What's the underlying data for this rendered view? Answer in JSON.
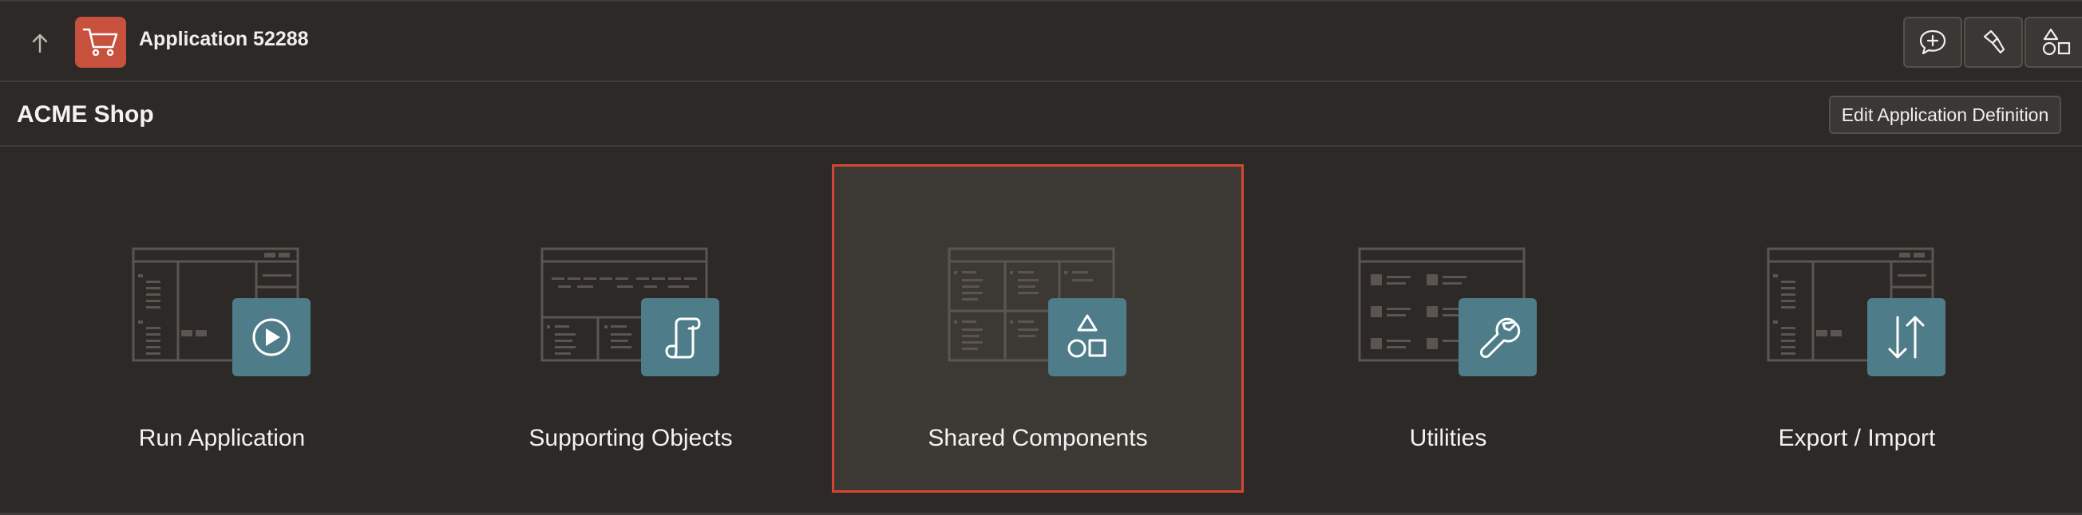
{
  "topbar": {
    "up_icon": "arrow-up-icon",
    "app_icon": "shopping-cart-icon",
    "app_title": "Application 52288",
    "buttons": [
      {
        "name": "feedback-button",
        "icon": "chat-plus-icon"
      },
      {
        "name": "debug-button",
        "icon": "flashlight-icon"
      },
      {
        "name": "shared-components-button",
        "icon": "shapes-icon"
      }
    ]
  },
  "region": {
    "title": "ACME Shop",
    "edit_button_label": "Edit Application Definition"
  },
  "tiles": [
    {
      "label": "Run Application",
      "icon": "play-icon",
      "selected": false
    },
    {
      "label": "Supporting Objects",
      "icon": "scroll-icon",
      "selected": false
    },
    {
      "label": "Shared Components",
      "icon": "shapes-icon",
      "selected": true
    },
    {
      "label": "Utilities",
      "icon": "wrench-icon",
      "selected": false
    },
    {
      "label": "Export / Import",
      "icon": "arrows-up-down-icon",
      "selected": false
    }
  ],
  "colors": {
    "background": "#2c2927",
    "app_icon_bg": "#c8513e",
    "selected_border": "#d54632",
    "tile_badge": "#4e7c89"
  }
}
